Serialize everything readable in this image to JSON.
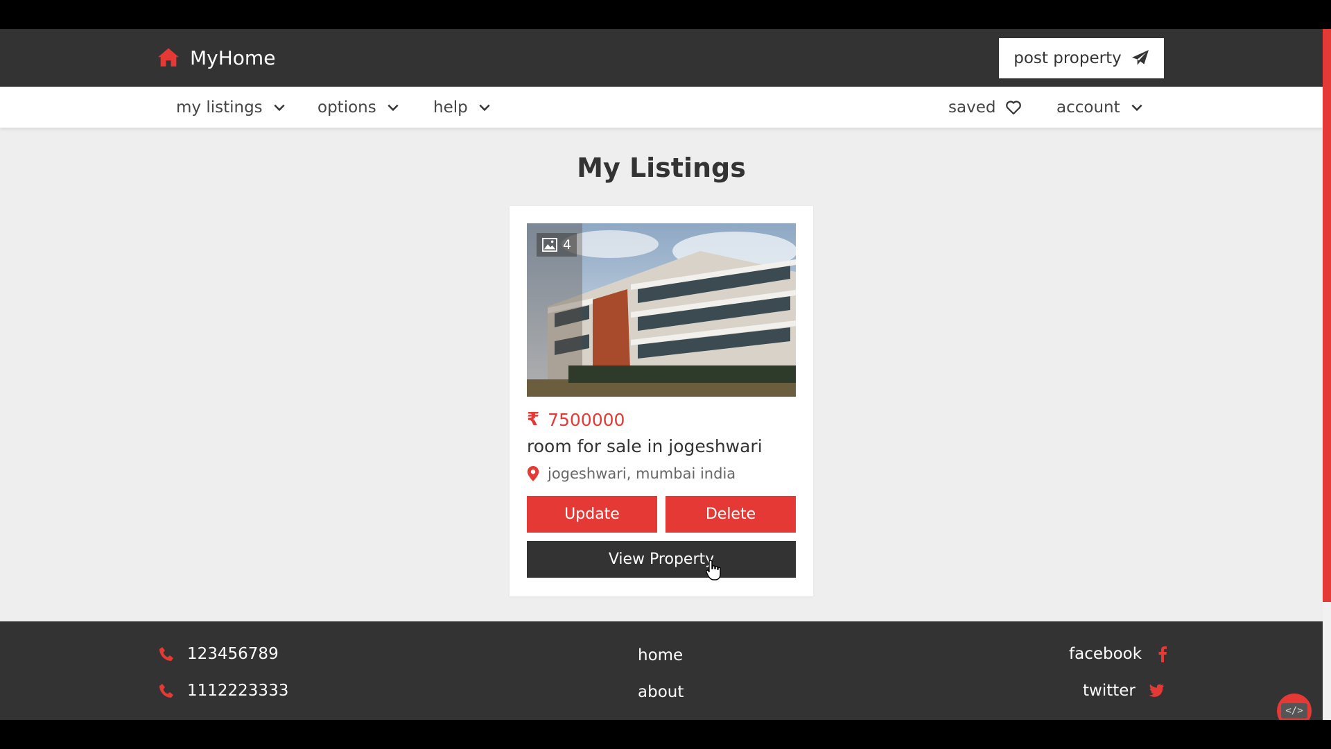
{
  "header": {
    "brand": "MyHome",
    "post_property_label": "post property"
  },
  "nav": {
    "my_listings": "my listings",
    "options": "options",
    "help": "help",
    "saved": "saved",
    "account": "account"
  },
  "main": {
    "title": "My Listings",
    "listing": {
      "photo_count": "4",
      "currency_symbol": "₹",
      "price": "7500000",
      "title": "room for sale in jogeshwari",
      "location": "jogeshwari, mumbai india",
      "update_label": "Update",
      "delete_label": "Delete",
      "view_label": "View Property"
    }
  },
  "footer": {
    "phones": [
      "123456789",
      "1112223333"
    ],
    "links": [
      "home",
      "about"
    ],
    "social": [
      "facebook",
      "twitter"
    ]
  },
  "dev_button_label": "</>",
  "colors": {
    "accent": "#e53935",
    "dark": "#333333",
    "background": "#eeeeee"
  }
}
